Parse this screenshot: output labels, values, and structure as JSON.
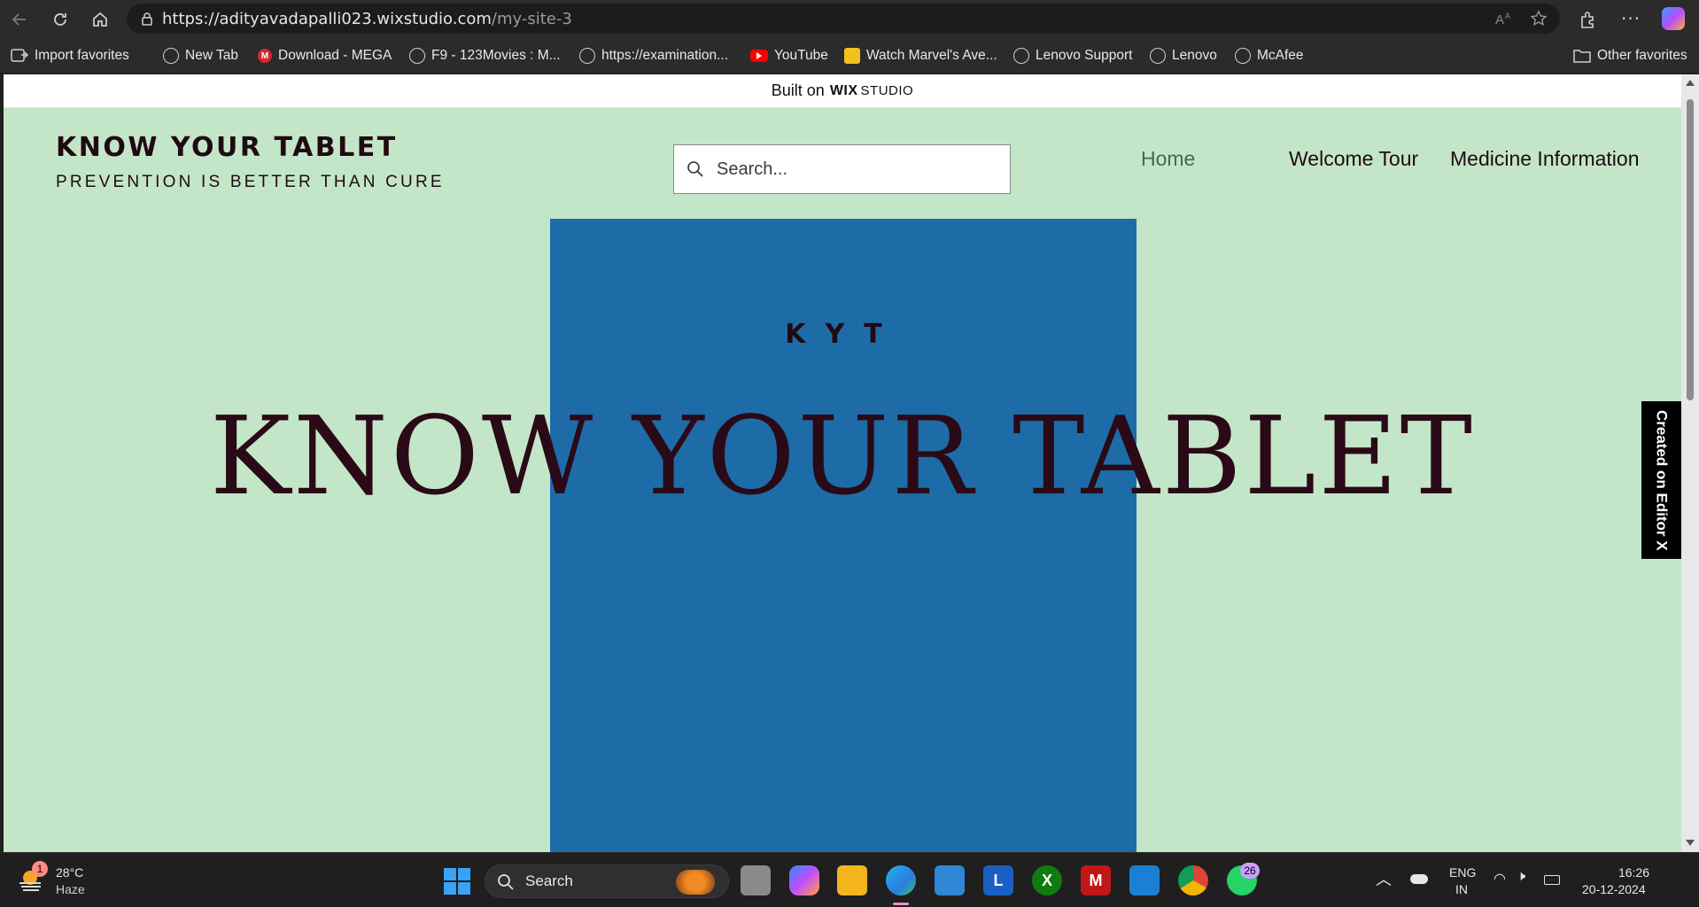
{
  "browser": {
    "url_host": "https://adityavadapalli023.wixstudio.com",
    "url_path": "/my-site-3",
    "favorites": [
      {
        "label": "Import favorites",
        "icon": "import-icon"
      },
      {
        "label": "New Tab",
        "icon": "globe-icon"
      },
      {
        "label": "Download - MEGA",
        "icon": "mega-icon"
      },
      {
        "label": "F9 - 123Movies : M...",
        "icon": "globe-icon"
      },
      {
        "label": "https://examination...",
        "icon": "globe-icon"
      },
      {
        "label": "YouTube",
        "icon": "youtube-icon"
      },
      {
        "label": "Watch Marvel's Ave...",
        "icon": "site-icon"
      },
      {
        "label": "Lenovo Support",
        "icon": "globe-icon"
      },
      {
        "label": "Lenovo",
        "icon": "globe-icon"
      },
      {
        "label": "McAfee",
        "icon": "globe-icon"
      }
    ],
    "other_favorites": "Other favorites"
  },
  "wix_banner": {
    "built_on": "Built on",
    "brand": "WIX",
    "product": "STUDIO"
  },
  "site": {
    "title": "KNOW YOUR TABLET",
    "tagline": "PREVENTION IS BETTER THAN CURE",
    "search_placeholder": "Search...",
    "nav": [
      {
        "label": "Home"
      },
      {
        "label": "Welcome Tour"
      },
      {
        "label": "Medicine Information"
      }
    ],
    "hero_small": "KYT",
    "hero_title": "KNOW YOUR TABLET",
    "editor_badge": "Created on Editor X",
    "colors": {
      "background": "#c4e6c8",
      "hero_block": "#1d6ca8",
      "text": "#2a0a17",
      "nav_active": "#3c6e4c"
    }
  },
  "taskbar": {
    "weather_temp": "28°C",
    "weather_desc": "Haze",
    "weather_badge": "1",
    "search_label": "Search",
    "whatsapp_badge": "26",
    "lang_line1": "ENG",
    "lang_line2": "IN",
    "time": "16:26",
    "date": "20-12-2024"
  }
}
